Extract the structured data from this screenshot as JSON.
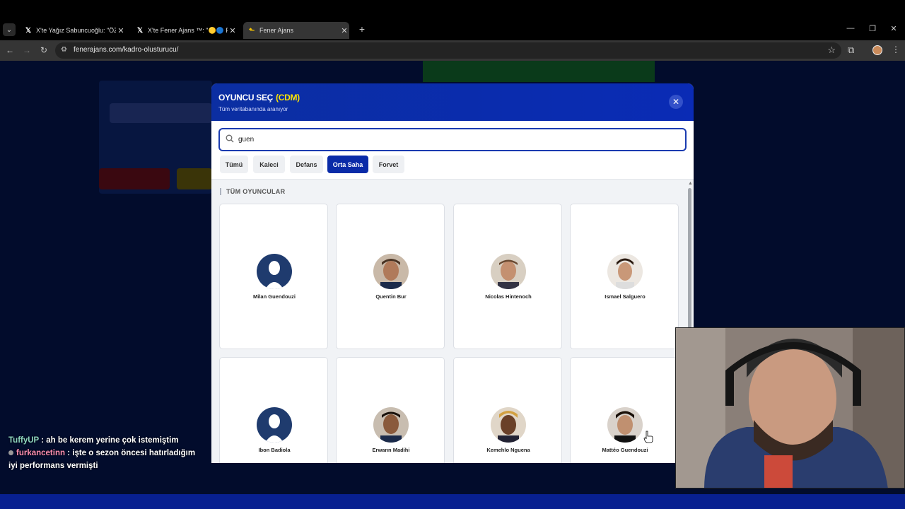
{
  "browser": {
    "tabs": [
      {
        "title": "X'te Yağız Sabuncuoğlu: \"ÖZEL",
        "favicon": "x-logo"
      },
      {
        "title": "X'te Fener Ajans ™: \"🟡🔵 Fen",
        "favicon": "x-logo"
      },
      {
        "title": "Fener Ajans",
        "favicon": "fener-ajans-logo",
        "active": true
      }
    ],
    "url": "fenerajans.com/kadro-olusturucu/"
  },
  "modal": {
    "title": "OYUNCU SEÇ",
    "badge": "(CDM)",
    "subtitle": "Tüm veritabanında aranıyor",
    "search_value": "guen",
    "filters": [
      "Tümü",
      "Kaleci",
      "Defans",
      "Orta Saha",
      "Forvet"
    ],
    "active_filter": "Orta Saha",
    "section_label": "TÜM OYUNCULAR",
    "players": [
      {
        "name": "Milan Guendouzi",
        "photo": "placeholder"
      },
      {
        "name": "Quentin Bur",
        "photo": "photo"
      },
      {
        "name": "Nicolas Hintenoch",
        "photo": "photo"
      },
      {
        "name": "Ismael Salguero",
        "photo": "photo"
      },
      {
        "name": "Ibon Badiola",
        "photo": "placeholder"
      },
      {
        "name": "Erwann Madihi",
        "photo": "photo"
      },
      {
        "name": "Kemehlo Nguena",
        "photo": "photo"
      },
      {
        "name": "Mattéo Guendouzi",
        "photo": "photo"
      }
    ]
  },
  "chat": [
    {
      "user": "TuffyUP",
      "message": "ah be kerem yerine çok istemiştim"
    },
    {
      "user": "furkancetinn",
      "message": "işte o sezon öncesi hatırladığım iyi performans vermişti"
    }
  ],
  "colors": {
    "accent": "#0a2ba8",
    "badge": "#ffe600",
    "page_bg": "#020c2c"
  }
}
